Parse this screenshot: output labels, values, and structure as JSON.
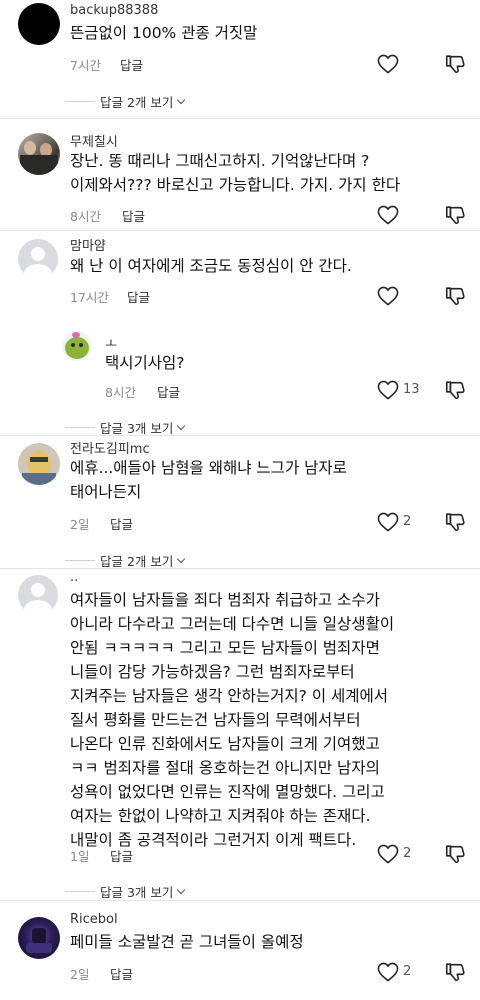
{
  "comments": [
    {
      "username": "backup88388",
      "text": [
        "뜬금없이 100% 관종 거짓말"
      ],
      "time": "7시간",
      "reply_label": "답글",
      "likes": "",
      "show_replies": "답글 2개 보기"
    },
    {
      "username": "무제칠시",
      "text": [
        "장난. 똥 때리나 그때신고하지. 기억않난다며 ?",
        "이제와서??? 바로신고 가능합니다. 가지. 가지 한다"
      ],
      "time": "8시간",
      "reply_label": "답글",
      "likes": ""
    },
    {
      "username": "맘마얌",
      "text": [
        "왜 난 이 여자에게 조금도 동정심이 안 간다."
      ],
      "time": "17시간",
      "reply_label": "답글",
      "likes": "",
      "replies": [
        {
          "username": "ㅗ",
          "text": [
            "택시기사임?"
          ],
          "time": "8시간",
          "reply_label": "답글",
          "likes": "13"
        }
      ],
      "show_replies": "답글 3개 보기"
    },
    {
      "username": "전라도김피mc",
      "text": [
        "에휴...애들아 남혐을 왜해냐 느그가 남자로",
        "태어나든지"
      ],
      "time": "2일",
      "reply_label": "답글",
      "likes": "2",
      "show_replies": "답글 2개 보기"
    },
    {
      "username": "..",
      "text": [
        "여자들이 남자들을 죄다 범죄자 취급하고 소수가",
        "아니라 다수라고 그러는데 다수면 니들 일상생활이",
        "안됨 ㅋㅋㅋㅋㅋ 그리고 모든 남자들이 범죄자면",
        "니들이 감당 가능하겠음? 그런 범죄자로부터",
        "지켜주는 남자들은 생각 안하는거지? 이 세계에서",
        "질서 평화를 만드는건 남자들의 무력에서부터",
        "나온다 인류 진화에서도 남자들이 크게 기여했고",
        "ㅋㅋ 범죄자를 절대 옹호하는건 아니지만 남자의",
        "성욕이 없었다면 인류는 진작에 멸망했다. 그리고",
        "여자는 한없이 나약하고 지켜줘야 하는 존재다.",
        "내말이 좀 공격적이라 그런거지 이게 팩트다."
      ],
      "time": "1일",
      "reply_label": "답글",
      "likes": "2",
      "show_replies": "답글 3개 보기"
    },
    {
      "username": "Ricebol",
      "text": [
        "페미들 소굴발견 곧 그녀들이 올예정"
      ],
      "time": "2일",
      "reply_label": "답글",
      "likes": "2"
    }
  ],
  "icons": {
    "like": "heart-outline-icon",
    "dislike": "thumbs-down-icon",
    "expand": "chevron-down-icon"
  },
  "colors": {
    "text": "#111111",
    "meta": "#8a8a8a",
    "divider": "#e5e5e5"
  }
}
